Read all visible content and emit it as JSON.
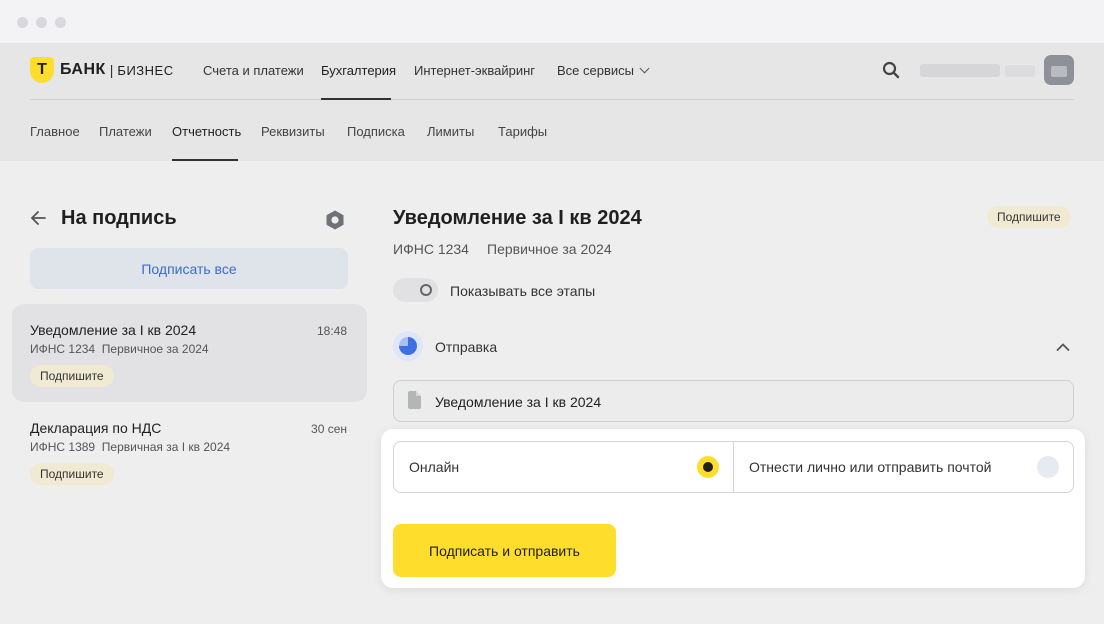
{
  "brand": {
    "logo_letter": "Т",
    "name": "БАНК",
    "separator": "|",
    "suffix": "БИЗНЕС",
    "accent": "#ffdd2d"
  },
  "top_nav": [
    {
      "label": "Счета и платежи"
    },
    {
      "label": "Бухгалтерия",
      "active": true
    },
    {
      "label": "Интернет-эквайринг"
    },
    {
      "label": "Все сервисы",
      "has_dropdown": true
    }
  ],
  "sub_nav": [
    {
      "label": "Главное"
    },
    {
      "label": "Платежи"
    },
    {
      "label": "Отчетность",
      "active": true
    },
    {
      "label": "Реквизиты"
    },
    {
      "label": "Подписка"
    },
    {
      "label": "Лимиты"
    },
    {
      "label": "Тарифы"
    }
  ],
  "header_icons": {
    "search": "search-icon",
    "avatar": "briefcase-avatar"
  },
  "left_panel": {
    "title": "На подпись",
    "sign_all_label": "Подписать все",
    "documents": [
      {
        "title": "Уведомление за I кв 2024",
        "time": "18:48",
        "subtitle": "ИФНС 1234  Первичное за 2024",
        "badge": "Подпишите",
        "selected": true
      },
      {
        "title": "Декларация по НДС",
        "time": "30 сен",
        "subtitle": "ИФНС 1389  Первичная за I кв 2024",
        "badge": "Подпишите",
        "selected": false
      }
    ]
  },
  "detail": {
    "title": "Уведомление за I кв 2024",
    "status_badge": "Подпишите",
    "inspection": "ИФНС 1234",
    "report_type": "Первичное за 2024",
    "show_all_stages_label": "Показывать все этапы",
    "show_all_stages_on": false,
    "stage_label": "Отправка",
    "file_name": "Уведомление за I кв 2024",
    "methods": [
      {
        "label": "Онлайн",
        "selected": true
      },
      {
        "label": "Отнести лично или отправить почтой",
        "selected": false
      }
    ],
    "submit_label": "Подписать и отправить"
  }
}
